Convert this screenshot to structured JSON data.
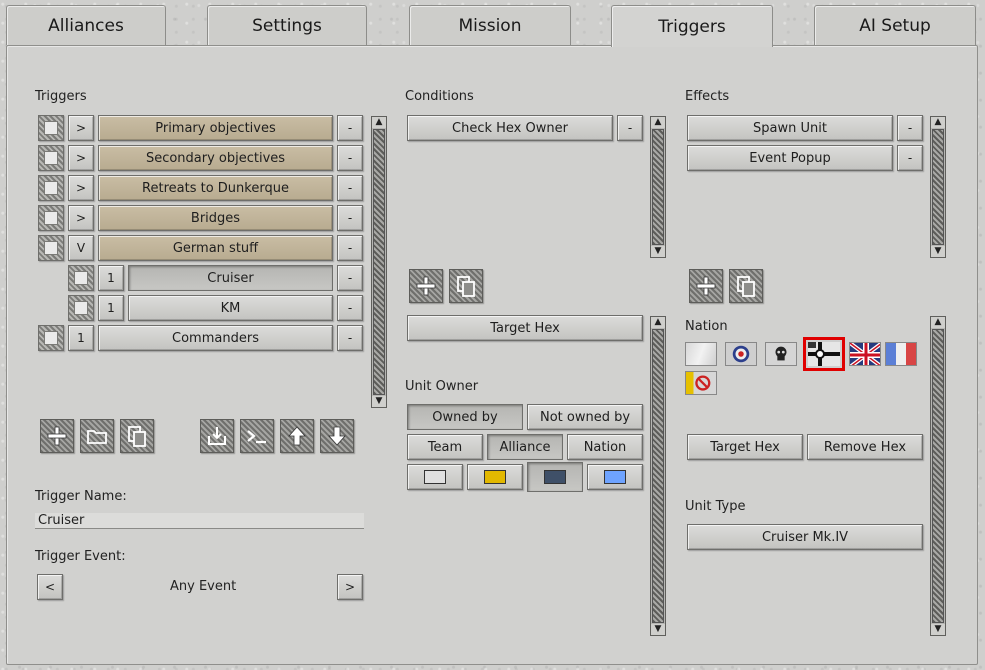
{
  "tabs": [
    "Alliances",
    "Settings",
    "Mission",
    "Triggers",
    "AI Setup"
  ],
  "triggers": {
    "heading": "Triggers",
    "items": [
      {
        "toggle": ">",
        "label": "Primary objectives",
        "remove": "-"
      },
      {
        "toggle": ">",
        "label": "Secondary objectives",
        "remove": "-"
      },
      {
        "toggle": ">",
        "label": "Retreats to Dunkerque",
        "remove": "-"
      },
      {
        "toggle": ">",
        "label": "Bridges",
        "remove": "-"
      },
      {
        "toggle": "V",
        "label": "German stuff",
        "remove": "-"
      },
      {
        "toggle": "1",
        "label": "Cruiser",
        "remove": "-"
      },
      {
        "toggle": "1",
        "label": "KM",
        "remove": "-"
      },
      {
        "toggle": "1",
        "label": "Commanders",
        "remove": "-"
      }
    ],
    "name_label": "Trigger Name:",
    "name_value": "Cruiser",
    "event_label": "Trigger Event:",
    "event_prev": "<",
    "event_value": "Any Event",
    "event_next": ">"
  },
  "conditions": {
    "heading": "Conditions",
    "items": [
      {
        "label": "Check Hex Owner",
        "remove": "-"
      }
    ],
    "target_hex": "Target Hex",
    "unit_owner_label": "Unit Owner",
    "owned_by": "Owned by",
    "not_owned_by": "Not owned by",
    "team": "Team",
    "alliance": "Alliance",
    "nation": "Nation",
    "colors": [
      "#e0e0e0",
      "#e2b800",
      "#3f5068",
      "#6ea3ff"
    ]
  },
  "effects": {
    "heading": "Effects",
    "items": [
      {
        "label": "Spawn Unit",
        "remove": "-"
      },
      {
        "label": "Event Popup",
        "remove": "-"
      }
    ],
    "nation_label": "Nation",
    "target_hex": "Target Hex",
    "remove_hex": "Remove Hex",
    "unit_type_label": "Unit Type",
    "unit_type_value": "Cruiser Mk.IV"
  }
}
